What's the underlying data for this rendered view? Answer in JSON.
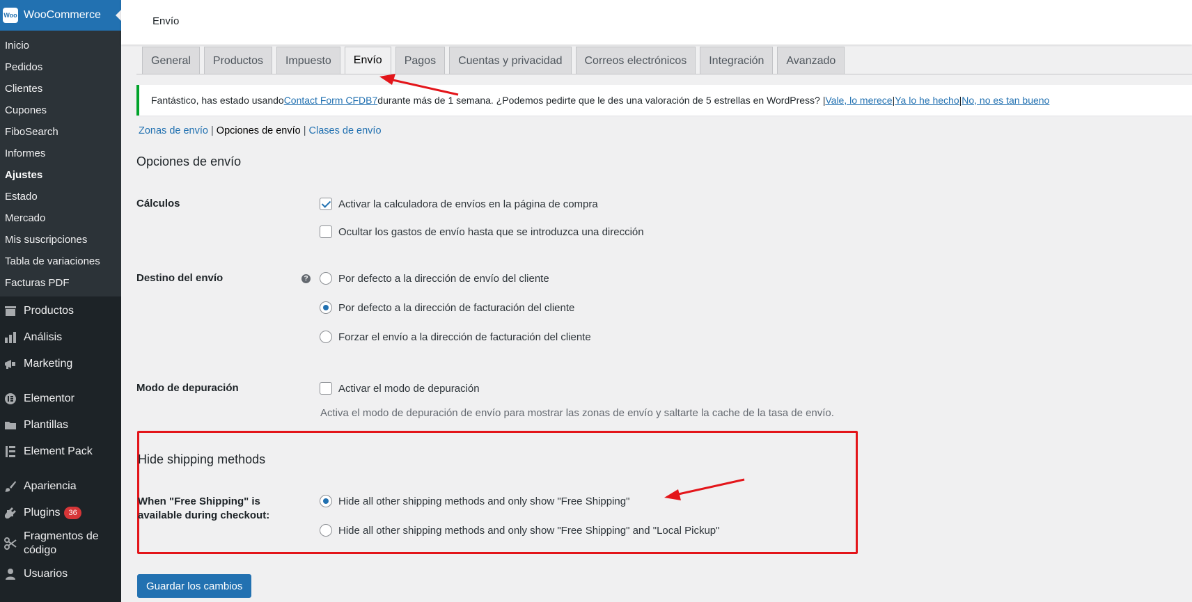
{
  "sidebar": {
    "brand": "WooCommerce",
    "brand_logo_text": "Woo",
    "submenu": [
      {
        "label": "Inicio"
      },
      {
        "label": "Pedidos"
      },
      {
        "label": "Clientes"
      },
      {
        "label": "Cupones"
      },
      {
        "label": "FiboSearch"
      },
      {
        "label": "Informes"
      },
      {
        "label": "Ajustes"
      },
      {
        "label": "Estado"
      },
      {
        "label": "Mercado"
      },
      {
        "label": "Mis suscripciones"
      },
      {
        "label": "Tabla de variaciones"
      },
      {
        "label": "Facturas PDF"
      }
    ],
    "menu": [
      {
        "label": "Productos",
        "icon": "products-icon"
      },
      {
        "label": "Análisis",
        "icon": "analytics-icon"
      },
      {
        "label": "Marketing",
        "icon": "megaphone-icon"
      },
      {
        "label": "Elementor",
        "icon": "elementor-icon"
      },
      {
        "label": "Plantillas",
        "icon": "folder-icon"
      },
      {
        "label": "Element Pack",
        "icon": "element-pack-icon"
      },
      {
        "label": "Apariencia",
        "icon": "paintbrush-icon"
      },
      {
        "label": "Plugins",
        "icon": "plugin-icon",
        "badge": "36"
      },
      {
        "label": "Fragmentos de código",
        "icon": "scissors-icon"
      },
      {
        "label": "Usuarios",
        "icon": "user-icon"
      }
    ]
  },
  "topbar": {
    "title": "Envío"
  },
  "tabs": [
    {
      "label": "General"
    },
    {
      "label": "Productos"
    },
    {
      "label": "Impuesto"
    },
    {
      "label": "Envío",
      "active": true
    },
    {
      "label": "Pagos"
    },
    {
      "label": "Cuentas y privacidad"
    },
    {
      "label": "Correos electrónicos"
    },
    {
      "label": "Integración"
    },
    {
      "label": "Avanzado"
    }
  ],
  "notice": {
    "text_before": "Fantástico, has estado usando ",
    "plugin_link": "Contact Form CFDB7",
    "text_after": " durante más de 1 semana. ¿Podemos pedirte que le des una valoración de 5 estrellas en WordPress? | ",
    "link_yes": "Vale, lo merece",
    "sep1": " | ",
    "link_done": "Ya lo he hecho",
    "sep2": " | ",
    "link_no": "No, no es tan bueno"
  },
  "subnav": {
    "zones": "Zonas de envío",
    "sep1": " | ",
    "options": "Opciones de envío",
    "sep2": " | ",
    "classes": "Clases de envío"
  },
  "section": {
    "title": "Opciones de envío",
    "calc_label": "Cálculos",
    "calc_opt1": "Activar la calculadora de envíos en la página de compra",
    "calc_opt2": "Ocultar los gastos de envío hasta que se introduzca una dirección",
    "dest_label": "Destino del envío",
    "dest_opt1": "Por defecto a la dirección de envío del cliente",
    "dest_opt2": "Por defecto a la dirección de facturación del cliente",
    "dest_opt3": "Forzar el envío a la dirección de facturación del cliente",
    "debug_label": "Modo de depuración",
    "debug_opt": "Activar el modo de depuración",
    "debug_desc": "Activa el modo de depuración de envío para mostrar las zonas de envío y saltarte la cache de la tasa de envío."
  },
  "hide_section": {
    "title": "Hide shipping methods",
    "label": "When \"Free Shipping\" is available during checkout:",
    "opt1": "Hide all other shipping methods and only show \"Free Shipping\"",
    "opt2": "Hide all other shipping methods and only show \"Free Shipping\" and \"Local Pickup\""
  },
  "save_button": "Guardar los cambios",
  "colors": {
    "annotation_red": "#e3151a",
    "wp_blue": "#2271b1",
    "sidebar_bg": "#1d2327"
  }
}
